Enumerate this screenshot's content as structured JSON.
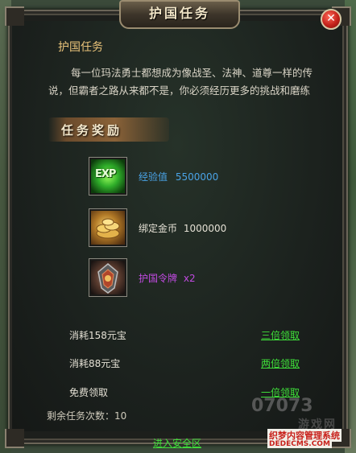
{
  "window": {
    "title": "护国任务",
    "close_label": "✕"
  },
  "quest": {
    "name": "护国任务",
    "description": "每一位玛法勇士都想成为像战圣、法神、道尊一样的传说，但霸者之路从来都不是，你必须经历更多的挑战和磨练"
  },
  "rewards": {
    "header": "任务奖励",
    "items": [
      {
        "icon": "exp-icon",
        "icon_text": "EXP",
        "label": "经验值",
        "value": "5500000",
        "color": "#4aa3e6"
      },
      {
        "icon": "gold-coins-icon",
        "label": "绑定金币",
        "value": "1000000",
        "color": "#e4e0d4"
      },
      {
        "icon": "token-icon",
        "label": "护国令牌",
        "value": "x2",
        "color": "#c04ae0"
      }
    ]
  },
  "claim_options": [
    {
      "cost": "消耗158元宝",
      "action": "三倍领取"
    },
    {
      "cost": "消耗88元宝",
      "action": "两倍领取"
    },
    {
      "cost": "免费领取",
      "action": "一倍领取"
    }
  ],
  "remaining": {
    "label": "剩余任务次数：",
    "value": "10"
  },
  "footer": {
    "enter_safe_zone": "进入安全区"
  },
  "watermark": {
    "logo": "07073",
    "site_cn": "游戏网",
    "overlay_cn": "织梦内容管理系统",
    "overlay_url": "DEDECMS.COM"
  }
}
